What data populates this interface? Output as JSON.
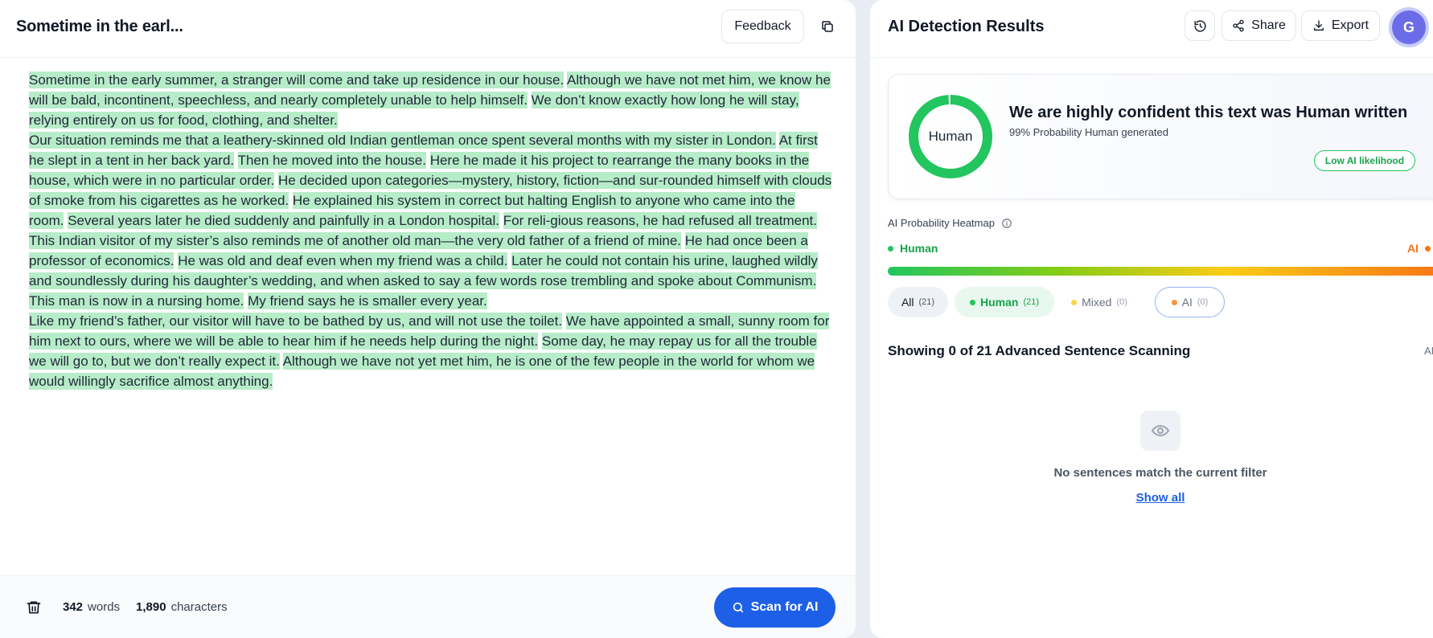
{
  "editor": {
    "title": "Sometime in the earl...",
    "feedback_label": "Feedback",
    "paragraphs": [
      [
        "Sometime in the early summer, a stranger will come and take up residence in our house.",
        "Although we have not met him, we know he will be bald, incontinent, speechless, and nearly completely unable to help himself.",
        "We don’t know exactly how long he will stay, relying entirely on us for food, clothing, and shelter."
      ],
      [
        "Our situation reminds me that a leathery-skinned old Indian gentleman once spent several months with my sister in London.",
        "At first he slept in a tent in her back yard.",
        "Then he moved into the house.",
        "Here he made it his project to rearrange the many books in the house, which were in no particular order.",
        "He decided upon categories—mystery, history, fiction—and sur-rounded himself with clouds of smoke from his cigarettes as he worked.",
        "He explained his system in correct but halting English to anyone who came into the room.",
        "Several years later he died suddenly and painfully in a London hospital.",
        "For reli-gious reasons, he had refused all treatment."
      ],
      [
        "This Indian visitor of my sister’s also reminds me of another old man—the very old father of a friend of mine.",
        "He had once been a professor of economics.",
        "He was old and deaf even when my friend was a child.",
        "Later he could not contain his urine, laughed wildly and soundlessly during his daughter’s wedding, and when asked to say a few words rose trembling and spoke about Communism.",
        "This man is now in a nursing home.",
        "My friend says he is smaller every year."
      ],
      [
        "Like my friend’s father, our visitor will have to be bathed by us, and will not use the toilet.",
        "We have appointed a small, sunny room for him next to ours, where we will be able to hear him if he needs help during the night.",
        "Some day, he may repay us for all the trouble we will go to, but we don’t really expect it.",
        "Although we have not yet met him, he is one of the few people in the world for whom we would willingly sacrifice almost anything."
      ]
    ],
    "footer": {
      "word_count": "342",
      "word_label": "words",
      "char_count": "1,890",
      "char_label": "characters",
      "scan_label": "Scan for AI"
    }
  },
  "results": {
    "title": "AI Detection Results",
    "share_label": "Share",
    "export_label": "Export",
    "avatar_initial": "G",
    "verdict": {
      "donut_label": "Human",
      "human_probability": 0.99,
      "headline": "We are highly confident this text was Human written",
      "subtext": "99% Probability Human generated",
      "badge": "Low AI likelihood"
    },
    "heatmap": {
      "title": "AI Probability Heatmap",
      "legend_left": "Human",
      "legend_right": "AI"
    },
    "filters": [
      {
        "label": "All",
        "count": "(21)"
      },
      {
        "label": "Human",
        "count": "(21)"
      },
      {
        "label": "Mixed",
        "count": "(0)"
      },
      {
        "label": "AI",
        "count": "(0)"
      }
    ],
    "showing_text": "Showing 0 of 21 Advanced Sentence Scanning",
    "showing_right": "AI",
    "empty_text": "No sentences match the current filter",
    "show_all_label": "Show all"
  },
  "colors": {
    "highlight_human": "#b7ecc8",
    "primary": "#1d5fe6",
    "human_green": "#22c55e",
    "ai_orange": "#f97316",
    "mixed_yellow": "#fcd34d",
    "ai_dot": "#fb923c"
  }
}
